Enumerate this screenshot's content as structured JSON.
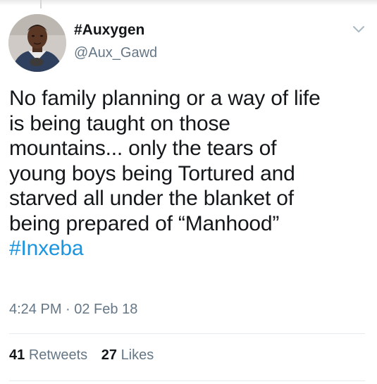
{
  "user": {
    "display_name": "#Auxygen",
    "handle": "@Aux_Gawd"
  },
  "tweet": {
    "lines": [
      "No family planning or a way of life",
      "is being taught on those",
      "mountains... only the tears of",
      "young boys being Tortured and",
      "starved all under the blanket of",
      "being prepared of “Manhood”"
    ],
    "hashtag": "#Inxeba",
    "timestamp": "4:24 PM · 02 Feb 18"
  },
  "stats": {
    "retweets_count": "41",
    "retweets_label": "Retweets",
    "likes_count": "27",
    "likes_label": "Likes"
  },
  "icons": {
    "menu": "chevron-down-icon"
  },
  "colors": {
    "link": "#1b95e0",
    "secondary_text": "#657786",
    "primary_text": "#14171a"
  }
}
